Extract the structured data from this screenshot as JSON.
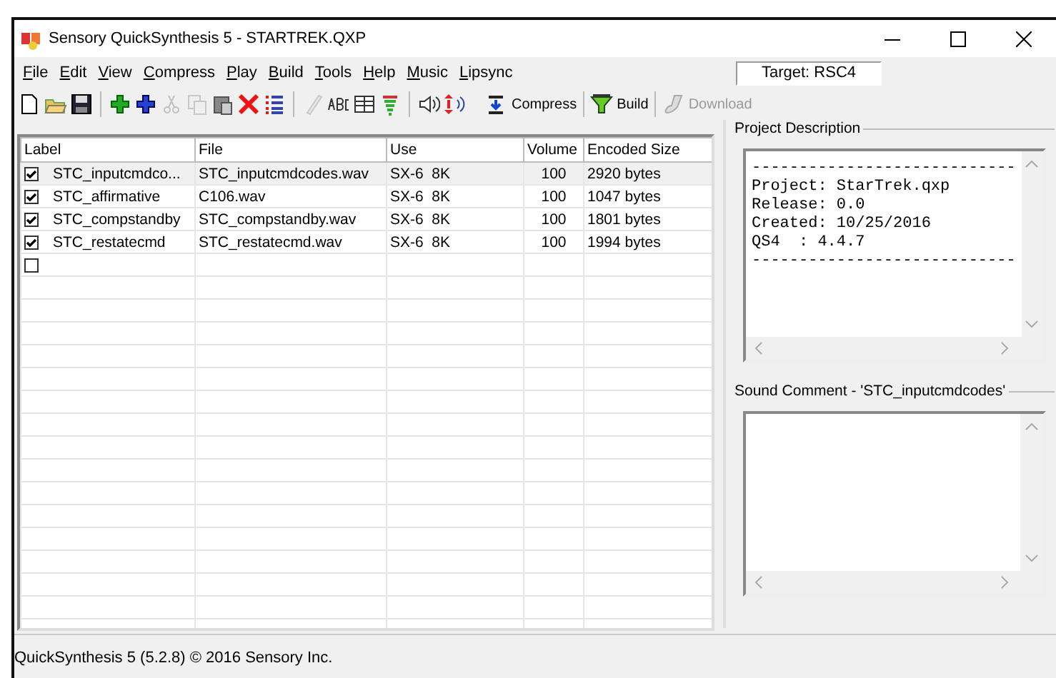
{
  "window": {
    "title": "Sensory QuickSynthesis 5 - STARTREK.QXP"
  },
  "menu": [
    "File",
    "Edit",
    "View",
    "Compress",
    "Play",
    "Build",
    "Tools",
    "Help",
    "Music",
    "Lipsync"
  ],
  "target": {
    "value": "Target: RSC4"
  },
  "toolbar": {
    "icons": [
      {
        "disabled": false
      },
      {
        "disabled": false
      },
      {
        "disabled": false
      },
      {
        "disabled": false
      },
      {
        "disabled": false
      },
      {
        "disabled": true
      },
      {
        "disabled": true
      },
      {
        "disabled": false
      },
      {
        "disabled": false
      },
      {
        "disabled": false
      },
      {
        "disabled": true
      },
      {
        "disabled": false
      },
      {
        "disabled": false
      },
      {
        "disabled": false
      },
      {
        "disabled": false
      },
      {
        "disabled": false
      }
    ],
    "buttons": [
      {
        "label": "Compress",
        "disabled": false
      },
      {
        "label": "Build",
        "disabled": false
      },
      {
        "label": "Download",
        "disabled": true
      }
    ]
  },
  "table": {
    "columns": [
      "Label",
      "File",
      "Use",
      "Volume",
      "Encoded Size"
    ],
    "rows": [
      {
        "checked": true,
        "selected": true,
        "label": "STC_inputcmdco...",
        "file": "STC_inputcmdcodes.wav",
        "use": "SX-6  8K",
        "volume": "100",
        "size": "2920 bytes"
      },
      {
        "checked": true,
        "selected": false,
        "label": "STC_affirmative",
        "file": "C106.wav",
        "use": "SX-6  8K",
        "volume": "100",
        "size": "1047 bytes"
      },
      {
        "checked": true,
        "selected": false,
        "label": "STC_compstandby",
        "file": "STC_compstandby.wav",
        "use": "SX-6  8K",
        "volume": "100",
        "size": "1801 bytes"
      },
      {
        "checked": true,
        "selected": false,
        "label": "STC_restatecmd",
        "file": "STC_restatecmd.wav",
        "use": "SX-6  8K",
        "volume": "100",
        "size": "1994 bytes"
      },
      {
        "checked": false,
        "selected": false
      }
    ]
  },
  "project_description": {
    "title": "Project Description",
    "lines": [
      "----------------------------",
      "Project: StarTrek.qxp",
      "Release: 0.0",
      "Created: 10/25/2016",
      "QS4  : 4.4.7",
      "----------------------------"
    ]
  },
  "sound_comment": {
    "title": "Sound Comment - 'STC_inputcmdcodes'"
  },
  "status_bar": {
    "text": "QuickSynthesis 5 (5.2.8) © 2016 Sensory Inc."
  }
}
